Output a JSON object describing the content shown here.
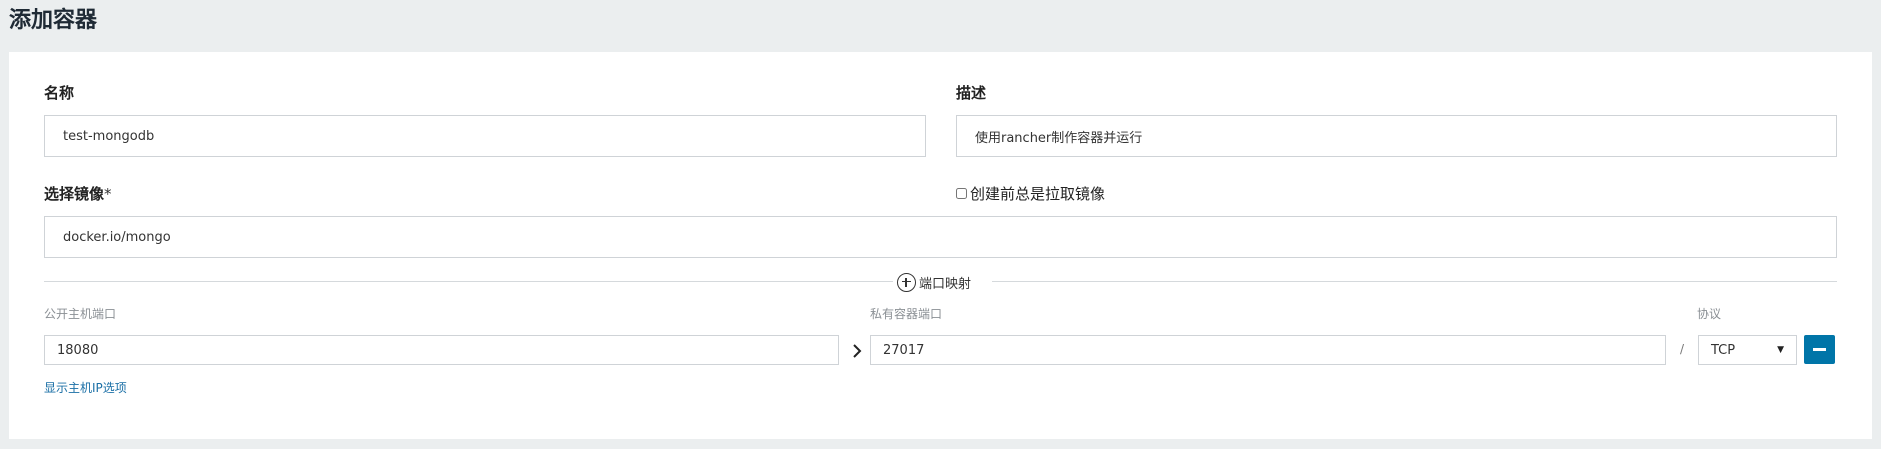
{
  "page": {
    "title": "添加容器"
  },
  "form": {
    "name": {
      "label": "名称",
      "value": "test-mongodb"
    },
    "description": {
      "label": "描述",
      "value": "使用rancher制作容器并运行"
    },
    "image": {
      "label": "选择镜像",
      "required_mark": "*",
      "value": "docker.io/mongo"
    },
    "always_pull": {
      "label": "创建前总是拉取镜像",
      "checked": false
    }
  },
  "port_mapping": {
    "add_label": "端口映射",
    "public_port_label": "公开主机端口",
    "private_port_label": "私有容器端口",
    "protocol_label": "协议",
    "separator": "/",
    "rows": [
      {
        "public_port": "18080",
        "private_port": "27017",
        "protocol": "TCP"
      }
    ],
    "show_host_ip_link": "显示主机IP选项"
  },
  "colors": {
    "accent": "#0075a8",
    "link": "#1a6fa6",
    "background": "#ebeeef"
  },
  "icons": {
    "add": "plus-circle-icon",
    "arrow": "chevron-right-icon",
    "remove": "minus-icon",
    "dropdown": "caret-down-icon"
  }
}
